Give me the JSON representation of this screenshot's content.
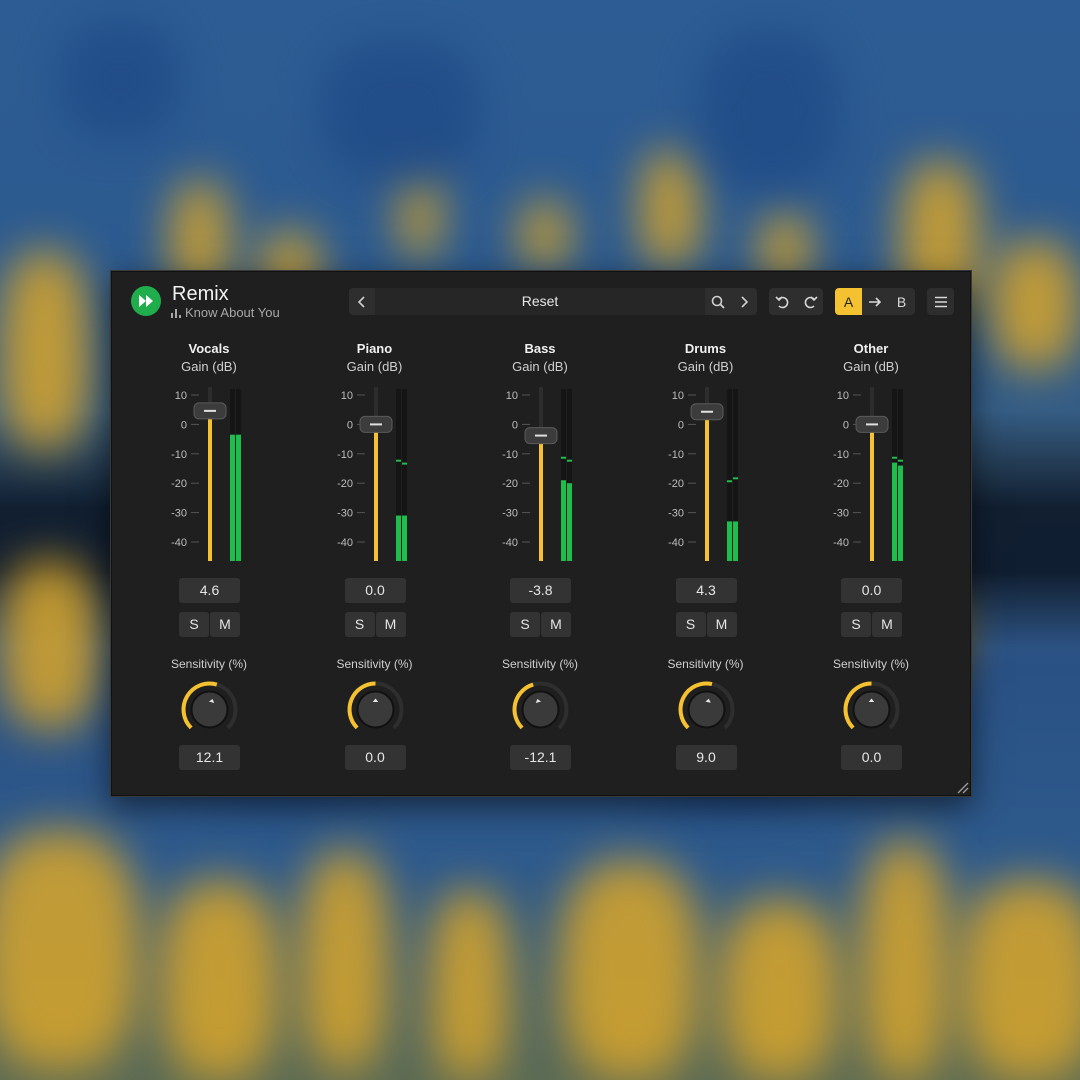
{
  "app": {
    "title": "Remix",
    "subtitle": "Know About You",
    "accent_color": "#f4c230",
    "logo_color": "#1fae4b",
    "meter_color": "#1fbd4e"
  },
  "toolbar": {
    "prev_icon": "chevron-left-icon",
    "preset_name": "Reset",
    "search_icon": "search-icon",
    "next_icon": "chevron-right-icon",
    "undo_icon": "undo-icon",
    "redo_icon": "redo-icon",
    "a_label": "A",
    "copy_icon": "arrow-right-icon",
    "b_label": "B",
    "menu_icon": "hamburger-menu-icon"
  },
  "scale_ticks": [
    "10",
    "0",
    "-10",
    "-20",
    "-30",
    "-40"
  ],
  "gain_label": "Gain (dB)",
  "sensitivity_label": "Sensitivity (%)",
  "solo_label": "S",
  "mute_label": "M",
  "channels": [
    {
      "name": "Vocals",
      "gain": "4.6",
      "gain_db": 4.6,
      "sensitivity": "12.1",
      "sensitivity_pct": 12.1,
      "meter": [
        -3.5,
        -3.5
      ],
      "peak": [
        -8,
        -8
      ]
    },
    {
      "name": "Piano",
      "gain": "0.0",
      "gain_db": 0.0,
      "sensitivity": "0.0",
      "sensitivity_pct": 0.0,
      "meter": [
        -31,
        -31
      ],
      "peak": [
        -12,
        -13
      ]
    },
    {
      "name": "Bass",
      "gain": "-3.8",
      "gain_db": -3.8,
      "sensitivity": "-12.1",
      "sensitivity_pct": -12.1,
      "meter": [
        -19,
        -20
      ],
      "peak": [
        -11,
        -12
      ]
    },
    {
      "name": "Drums",
      "gain": "4.3",
      "gain_db": 4.3,
      "sensitivity": "9.0",
      "sensitivity_pct": 9.0,
      "meter": [
        -33,
        -33
      ],
      "peak": [
        -19,
        -18
      ]
    },
    {
      "name": "Other",
      "gain": "0.0",
      "gain_db": 0.0,
      "sensitivity": "0.0",
      "sensitivity_pct": 0.0,
      "meter": [
        -13,
        -14
      ],
      "peak": [
        -11,
        -12
      ]
    }
  ]
}
